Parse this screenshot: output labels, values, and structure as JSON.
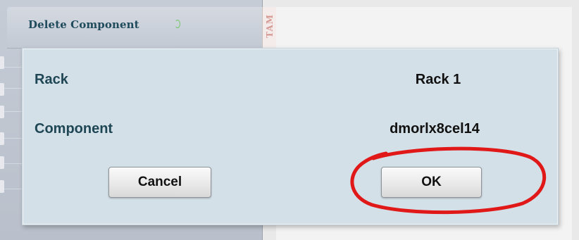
{
  "background": {
    "panel_title": "Delete Component",
    "vertical_tab_text": "TAM",
    "accent_color": "#1e4654",
    "annotation_color": "#e01818"
  },
  "dialog": {
    "rack_label": "Rack",
    "rack_value": "Rack 1",
    "component_label": "Component",
    "component_value": "dmorlx8cel14",
    "cancel_label": "Cancel",
    "ok_label": "OK"
  }
}
